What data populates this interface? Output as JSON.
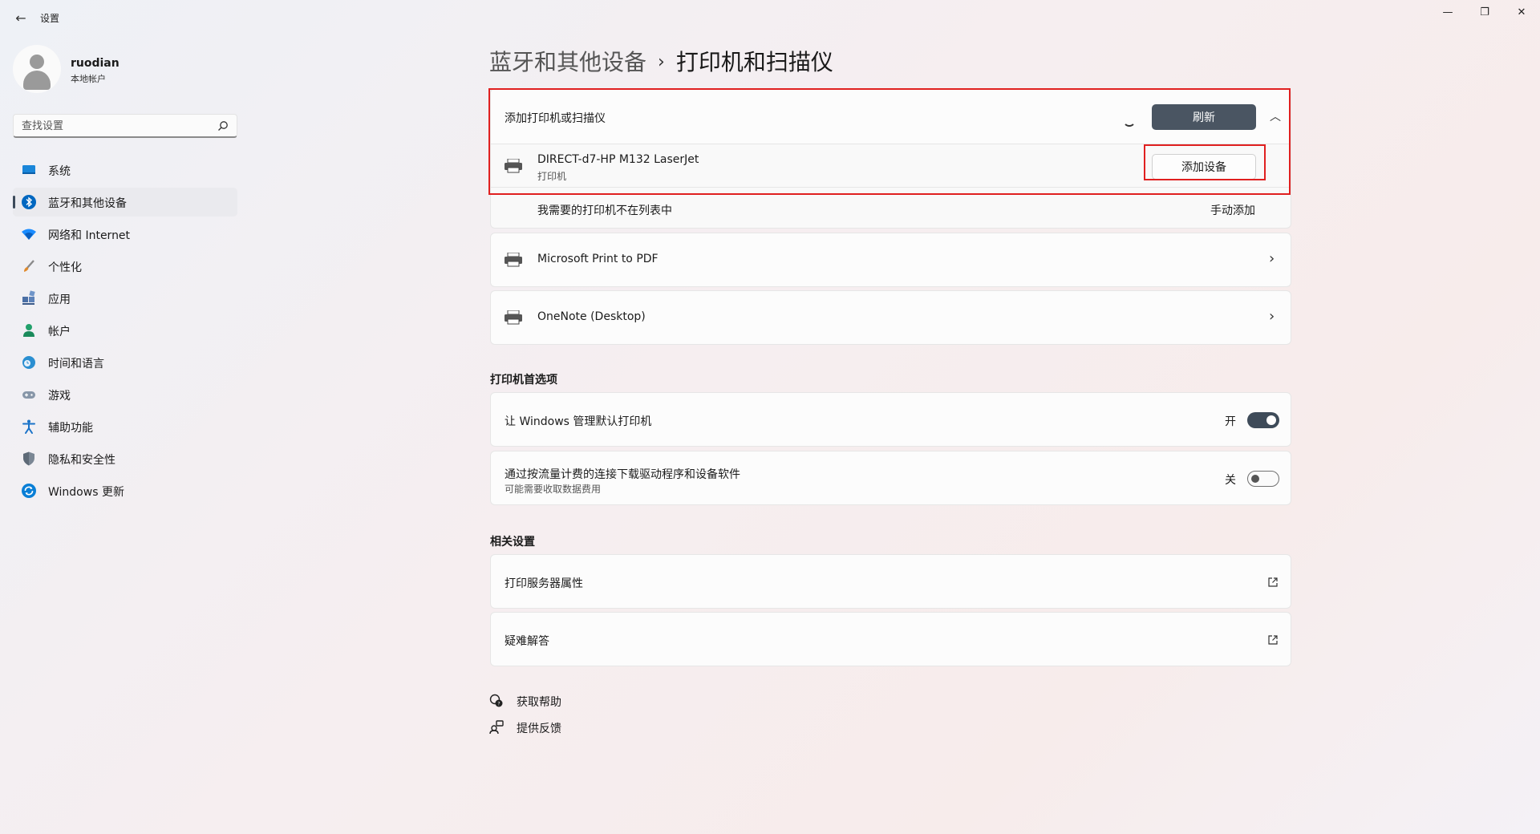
{
  "window": {
    "title": "设置",
    "back_icon": "back-arrow-icon",
    "controls": [
      "minimize-icon",
      "maximize-icon",
      "close-icon"
    ]
  },
  "profile": {
    "name": "ruodian",
    "account_type": "本地帐户"
  },
  "search": {
    "placeholder": "查找设置"
  },
  "nav": {
    "items": [
      {
        "label": "系统",
        "icon": "system-icon",
        "color": "#0078d4"
      },
      {
        "label": "蓝牙和其他设备",
        "icon": "bluetooth-icon",
        "color": "#0067c0"
      },
      {
        "label": "网络和 Internet",
        "icon": "wifi-icon",
        "color": "#1a8cff"
      },
      {
        "label": "个性化",
        "icon": "brush-icon",
        "color": "#d97a2b"
      },
      {
        "label": "应用",
        "icon": "apps-icon",
        "color": "#4a6fa5"
      },
      {
        "label": "帐户",
        "icon": "account-icon",
        "color": "#22a06b"
      },
      {
        "label": "时间和语言",
        "icon": "time-language-icon",
        "color": "#2b8fd1"
      },
      {
        "label": "游戏",
        "icon": "gaming-icon",
        "color": "#7a8ca0"
      },
      {
        "label": "辅助功能",
        "icon": "accessibility-icon",
        "color": "#1a73c8"
      },
      {
        "label": "隐私和安全性",
        "icon": "shield-icon",
        "color": "#6b7785"
      },
      {
        "label": "Windows 更新",
        "icon": "update-icon",
        "color": "#0a7fd6"
      }
    ],
    "active_index": 1
  },
  "breadcrumb": {
    "parent": "蓝牙和其他设备",
    "separator": "›",
    "current": "打印机和扫描仪"
  },
  "add_printer": {
    "title": "添加打印机或扫描仪",
    "refresh_label": "刷新",
    "device": {
      "name": "DIRECT-d7-HP M132 LaserJet",
      "type": "打印机",
      "add_label": "添加设备"
    },
    "not_listed_text": "我需要的打印机不在列表中",
    "manual_add_label": "手动添加"
  },
  "printers": [
    {
      "name": "Microsoft Print to PDF",
      "icon": "printer-icon"
    },
    {
      "name": "OneNote (Desktop)",
      "icon": "printer-icon"
    }
  ],
  "printer_prefs": {
    "section_title": "打印机首选项",
    "manage_default": {
      "label": "让 Windows 管理默认打印机",
      "state_text": "开",
      "on": true
    },
    "metered": {
      "label": "通过按流量计费的连接下载驱动程序和设备软件",
      "sublabel": "可能需要收取数据费用",
      "state_text": "关",
      "on": false
    }
  },
  "related": {
    "section_title": "相关设置",
    "items": [
      {
        "label": "打印服务器属性",
        "icon": "external-link-icon"
      },
      {
        "label": "疑难解答",
        "icon": "external-link-icon"
      }
    ]
  },
  "help": {
    "get_help": "获取帮助",
    "feedback": "提供反馈"
  },
  "colors": {
    "accent": "#4a5562",
    "highlight": "#e02020"
  }
}
